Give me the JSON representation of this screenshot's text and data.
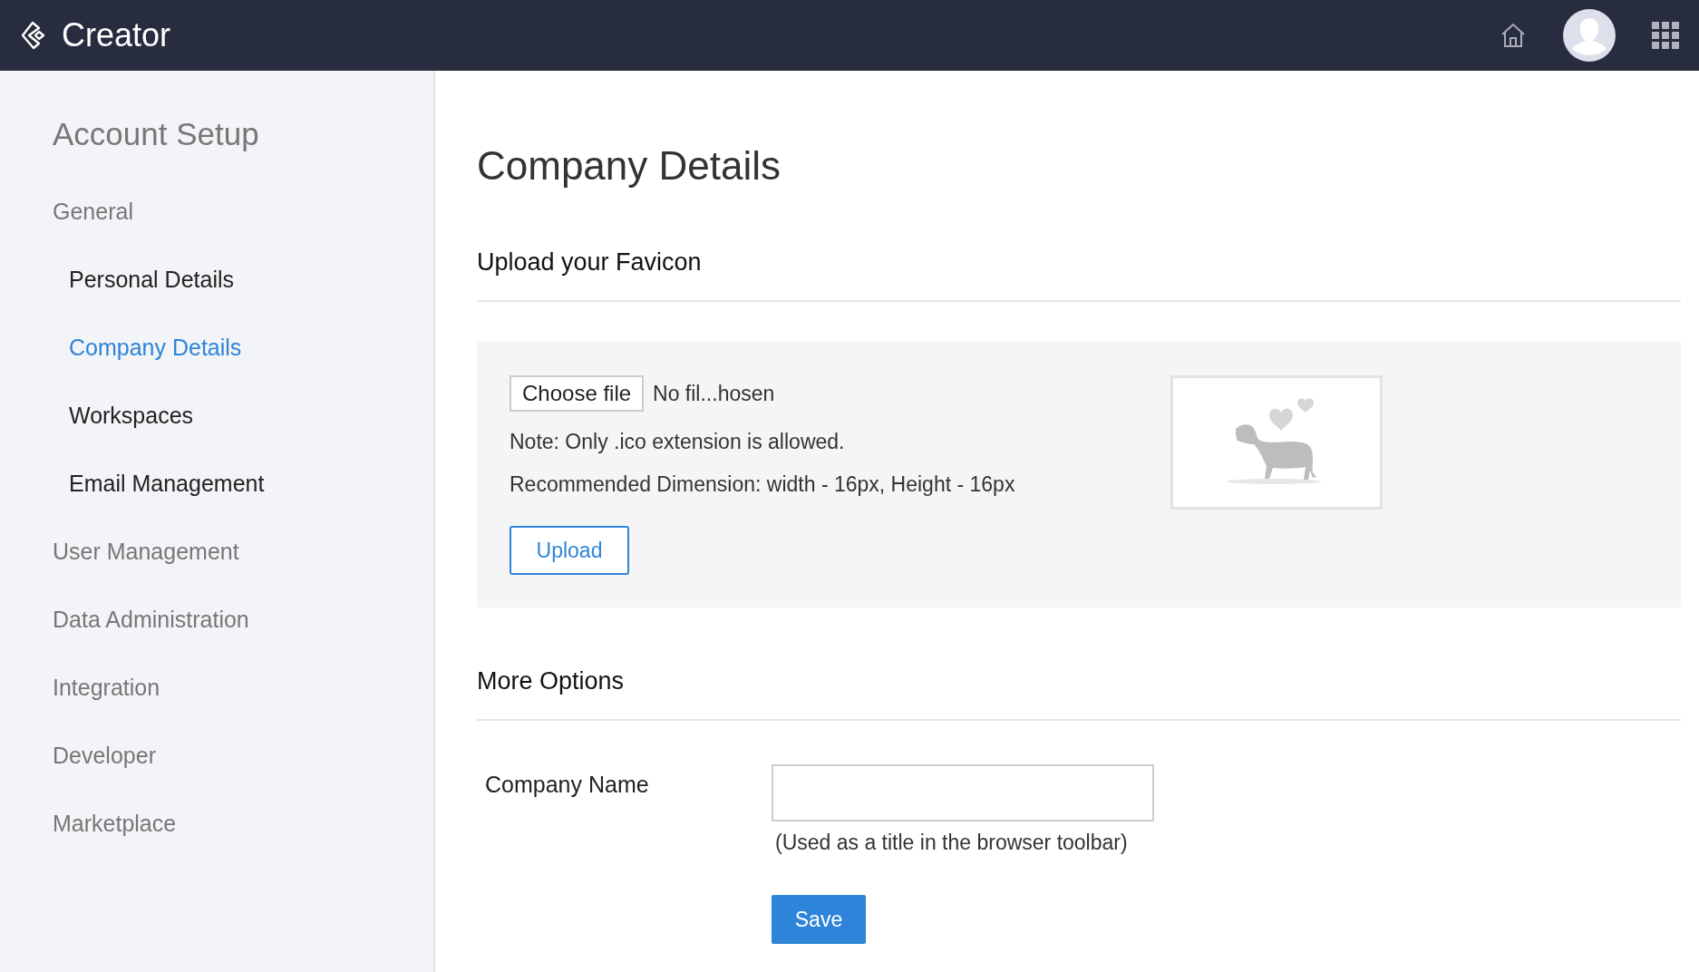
{
  "header": {
    "app_name": "Creator"
  },
  "sidebar": {
    "title": "Account Setup",
    "items": [
      {
        "label": "General",
        "selected": false,
        "children": [
          {
            "label": "Personal Details",
            "selected": false
          },
          {
            "label": "Company Details",
            "selected": true
          },
          {
            "label": "Workspaces",
            "selected": false
          },
          {
            "label": "Email Management",
            "selected": false
          }
        ]
      },
      {
        "label": "User Management",
        "selected": false
      },
      {
        "label": "Data Administration",
        "selected": false
      },
      {
        "label": "Integration",
        "selected": false
      },
      {
        "label": "Developer",
        "selected": false
      },
      {
        "label": "Marketplace",
        "selected": false
      }
    ]
  },
  "page": {
    "title": "Company Details",
    "favicon": {
      "heading": "Upload your Favicon",
      "choose_button": "Choose file",
      "file_status": "No fil...hosen",
      "note": "Note: Only .ico extension is allowed.",
      "dimension": "Recommended Dimension: width - 16px, Height - 16px",
      "upload_button": "Upload"
    },
    "more_options": {
      "heading": "More Options",
      "company_name_label": "Company Name",
      "company_name_hint": "(Used as a title in the browser toolbar)",
      "save_button": "Save"
    }
  }
}
